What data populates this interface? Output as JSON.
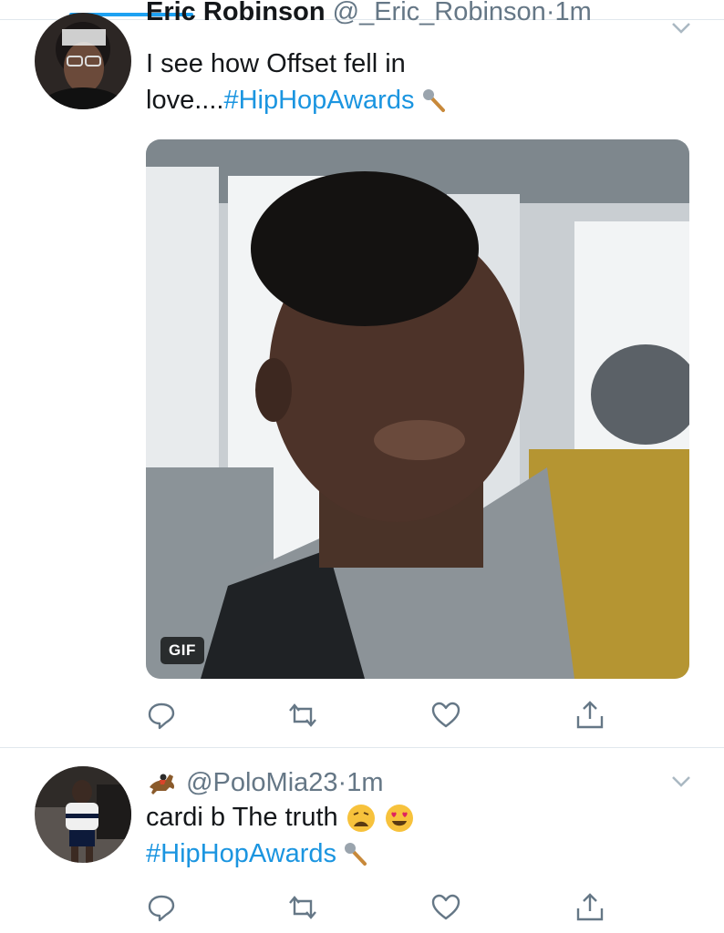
{
  "tweets": [
    {
      "display_name": "Eric Robinson",
      "handle": "@_Eric_Robinson",
      "separator": "·",
      "time": "1m",
      "text_part1": "I see how Offset fell in",
      "text_part2": "love....",
      "hashtag": "#HipHopAwards",
      "media_badge": "GIF"
    },
    {
      "handle": "@PoloMia23",
      "separator": "·",
      "time": "1m",
      "text": "cardi b The truth",
      "hashtag": "#HipHopAwards"
    }
  ],
  "icons": {
    "reply": "reply-icon",
    "retweet": "retweet-icon",
    "like": "heart-icon",
    "share": "share-icon",
    "menu": "chevron-down-icon"
  },
  "colors": {
    "hashtag": "#1b95e0",
    "secondary_text": "#657786",
    "divider": "#e1e8ed",
    "accent": "#1da1f2"
  }
}
